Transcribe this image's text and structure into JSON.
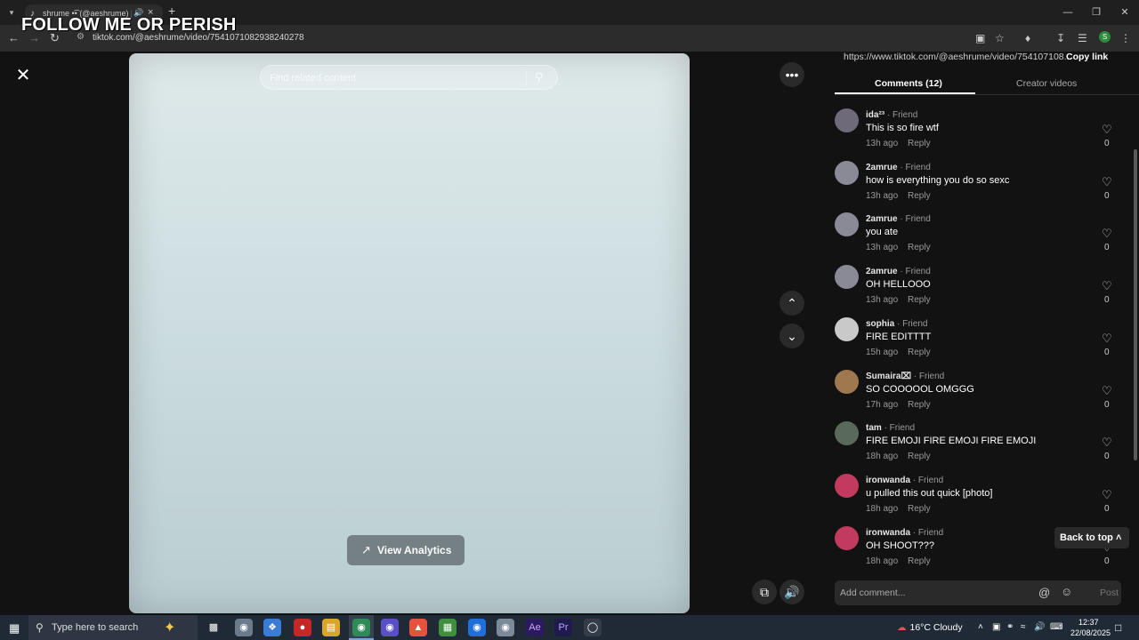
{
  "browser": {
    "tab_title": "shrume •͡• (@aeshrume) |",
    "new_tab": "+",
    "url": "tiktok.com/@aeshrume/video/7541071082938240278",
    "overlay_text": "FOLLOW ME OR PERISH"
  },
  "player": {
    "search_placeholder": "Find related content",
    "view_analytics_label": "View Analytics"
  },
  "panel": {
    "link_url": "https://www.tiktok.com/@aeshrume/video/754107108...",
    "copy_link": "Copy link",
    "tab_comments": "Comments (12)",
    "tab_creator": "Creator videos",
    "reply_label": "Reply",
    "back_to_top": "Back to top",
    "add_comment_placeholder": "Add comment...",
    "post_label": "Post",
    "comments": [
      {
        "author": "ida²³",
        "badge": " · Friend",
        "text": "This is so fire wtf",
        "time": "13h ago",
        "likes": "0",
        "avatar_color": "#6e6a7a"
      },
      {
        "author": "2amrue",
        "badge": " · Friend",
        "text": "how is everything you do so sexc",
        "time": "13h ago",
        "likes": "0",
        "avatar_color": "#8a8a96"
      },
      {
        "author": "2amrue",
        "badge": " · Friend",
        "text": "you ate",
        "time": "13h ago",
        "likes": "0",
        "avatar_color": "#8a8a96"
      },
      {
        "author": "2amrue",
        "badge": " · Friend",
        "text": "OH HELLOOO",
        "time": "13h ago",
        "likes": "0",
        "avatar_color": "#8a8a96"
      },
      {
        "author": "sophia",
        "badge": " · Friend",
        "text": "FIRE EDITTTT",
        "time": "15h ago",
        "likes": "0",
        "avatar_color": "#c9c9c9"
      },
      {
        "author": "Sumaira⌧",
        "badge": " · Friend",
        "text": "SO COOOOOL OMGGG",
        "time": "17h ago",
        "likes": "0",
        "avatar_color": "#a07850"
      },
      {
        "author": "tam",
        "badge": " · Friend",
        "text": "FIRE EMOJI FIRE EMOJI FIRE EMOJI",
        "time": "18h ago",
        "likes": "0",
        "avatar_color": "#5a6a5a"
      },
      {
        "author": "ironwanda",
        "badge": " · Friend",
        "text": "u pulled this out quick [photo]",
        "time": "18h ago",
        "likes": "0",
        "avatar_color": "#c23a5e"
      },
      {
        "author": "ironwanda",
        "badge": " · Friend",
        "text": "OH SHOOT???",
        "time": "18h ago",
        "likes": "0",
        "avatar_color": "#c23a5e"
      }
    ]
  },
  "taskbar": {
    "search_placeholder": "Type here to search",
    "weather": "16°C  Cloudy",
    "time": "12:37",
    "date": "22/08/2025"
  }
}
